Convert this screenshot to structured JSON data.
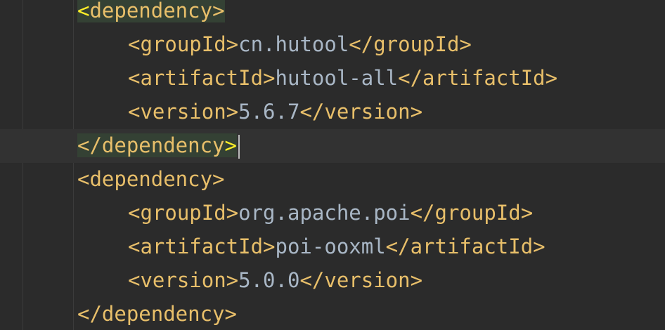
{
  "editor": {
    "lines": [
      {
        "open": "<",
        "name": "dependency",
        "close": ">"
      },
      {
        "tag_open": "<groupId>",
        "value": "cn.hutool",
        "tag_close": "</groupId>"
      },
      {
        "tag_open": "<artifactId>",
        "value": "hutool-all",
        "tag_close": "</artifactId>"
      },
      {
        "tag_open": "<version>",
        "value": "5.6.7",
        "tag_close": "</version>"
      },
      {
        "open": "</",
        "name": "dependency",
        "close": ">"
      },
      {
        "tag": "<dependency>"
      },
      {
        "tag_open": "<groupId>",
        "value": "org.apache.poi",
        "tag_close": "</groupId>"
      },
      {
        "tag_open": "<artifactId>",
        "value": "poi-ooxml",
        "tag_close": "</artifactId>"
      },
      {
        "tag_open": "<version>",
        "value": "5.0.0",
        "tag_close": "</version>"
      },
      {
        "tag": "</dependency>"
      }
    ]
  },
  "colors": {
    "background": "#2b2b2b",
    "tag": "#e8bf6a",
    "text": "#a9b7c6",
    "match_highlight": "#344134",
    "bracket_highlight": "#ffef28",
    "current_line": "#323232"
  }
}
